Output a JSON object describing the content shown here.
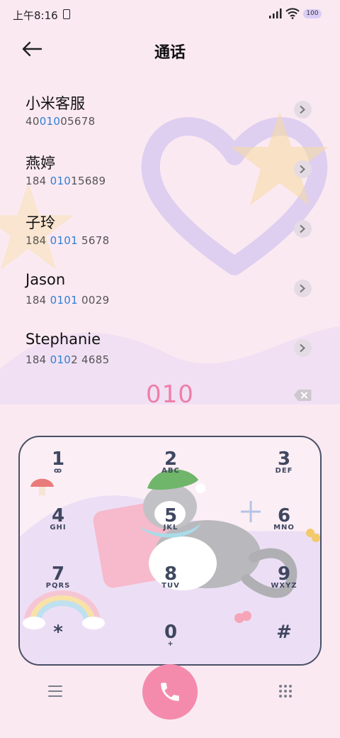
{
  "status_bar": {
    "time": "上午8:16",
    "battery": "100"
  },
  "header": {
    "title": "通话"
  },
  "contacts": [
    {
      "name": "小米客服",
      "num_pre": "40",
      "num_hl": "010",
      "num_post": "05678"
    },
    {
      "name": "燕婷",
      "num_pre": "184 ",
      "num_hl": "010",
      "num_post": "15689"
    },
    {
      "name": "子玲",
      "num_pre": "184 ",
      "num_hl": "0101",
      "num_post": " 5678"
    },
    {
      "name": "Jason",
      "num_pre": "184 ",
      "num_hl": "0101",
      "num_post": " 0029"
    },
    {
      "name": "Stephanie",
      "num_pre": "184 ",
      "num_hl": "010",
      "num_post": "2 4685"
    }
  ],
  "dialer": {
    "number": "010"
  },
  "keypad": [
    {
      "digit": "1",
      "letters": "ꝏ"
    },
    {
      "digit": "2",
      "letters": "ABC"
    },
    {
      "digit": "3",
      "letters": "DEF"
    },
    {
      "digit": "4",
      "letters": "GHI"
    },
    {
      "digit": "5",
      "letters": "JKL"
    },
    {
      "digit": "6",
      "letters": "MNO"
    },
    {
      "digit": "7",
      "letters": "PQRS"
    },
    {
      "digit": "8",
      "letters": "TUV"
    },
    {
      "digit": "9",
      "letters": "WXYZ"
    },
    {
      "digit": "*",
      "letters": ""
    },
    {
      "digit": "0",
      "letters": "+"
    },
    {
      "digit": "#",
      "letters": ""
    }
  ],
  "colors": {
    "accent_pink": "#ee7ea8",
    "call_button": "#f48bad",
    "highlight_blue": "#2f7fd3",
    "background": "#fbe9f2"
  },
  "icons": {
    "back": "arrow-left-icon",
    "chevron": "chevron-right-icon",
    "backspace": "backspace-icon",
    "menu": "menu-icon",
    "call": "phone-icon",
    "dialpad": "dialpad-icon"
  }
}
